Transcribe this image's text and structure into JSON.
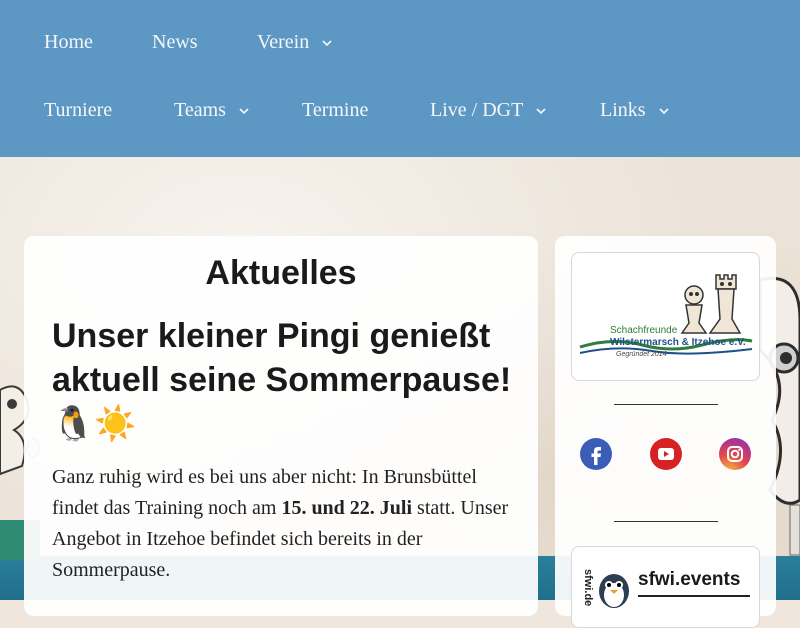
{
  "nav": {
    "items": [
      {
        "label": "Home",
        "dropdown": false
      },
      {
        "label": "News",
        "dropdown": false
      },
      {
        "label": "Verein",
        "dropdown": true
      },
      {
        "label": "Turniere",
        "dropdown": false
      },
      {
        "label": "Teams",
        "dropdown": true
      },
      {
        "label": "Termine",
        "dropdown": false
      },
      {
        "label": "Live / DGT",
        "dropdown": true
      },
      {
        "label": "Links",
        "dropdown": true
      }
    ]
  },
  "main": {
    "section_title": "Aktuelles",
    "post": {
      "title": "Unser kleiner Pingi genießt aktuell seine Sommerpause! 🐧☀️",
      "body_pre": "Ganz ruhig wird es bei uns aber nicht: In Brunsbüttel findet das Training noch am ",
      "body_bold": "15. und 22. Juli",
      "body_post": " statt. Unser Angebot in Itzehoe befindet sich bereits in der Sommerpause."
    }
  },
  "sidebar": {
    "logo": {
      "line1": "Schachfreunde",
      "line2": "Wilstermarsch & Itzehoe e.V.",
      "line3": "Gegründet 2014"
    },
    "social": [
      {
        "name": "facebook-icon",
        "color": "#3b5db7"
      },
      {
        "name": "youtube-icon",
        "color": "#d62222"
      },
      {
        "name": "instagram-icon",
        "color": "#c1358e"
      }
    ],
    "events": {
      "side_text": "sfwi.de",
      "name": "sfwi.events"
    }
  },
  "colors": {
    "nav_bg": "#5d98c4",
    "nav_text": "#f3f7fb",
    "logo_green": "#2e7d3a",
    "logo_blue": "#1f4f8a"
  }
}
